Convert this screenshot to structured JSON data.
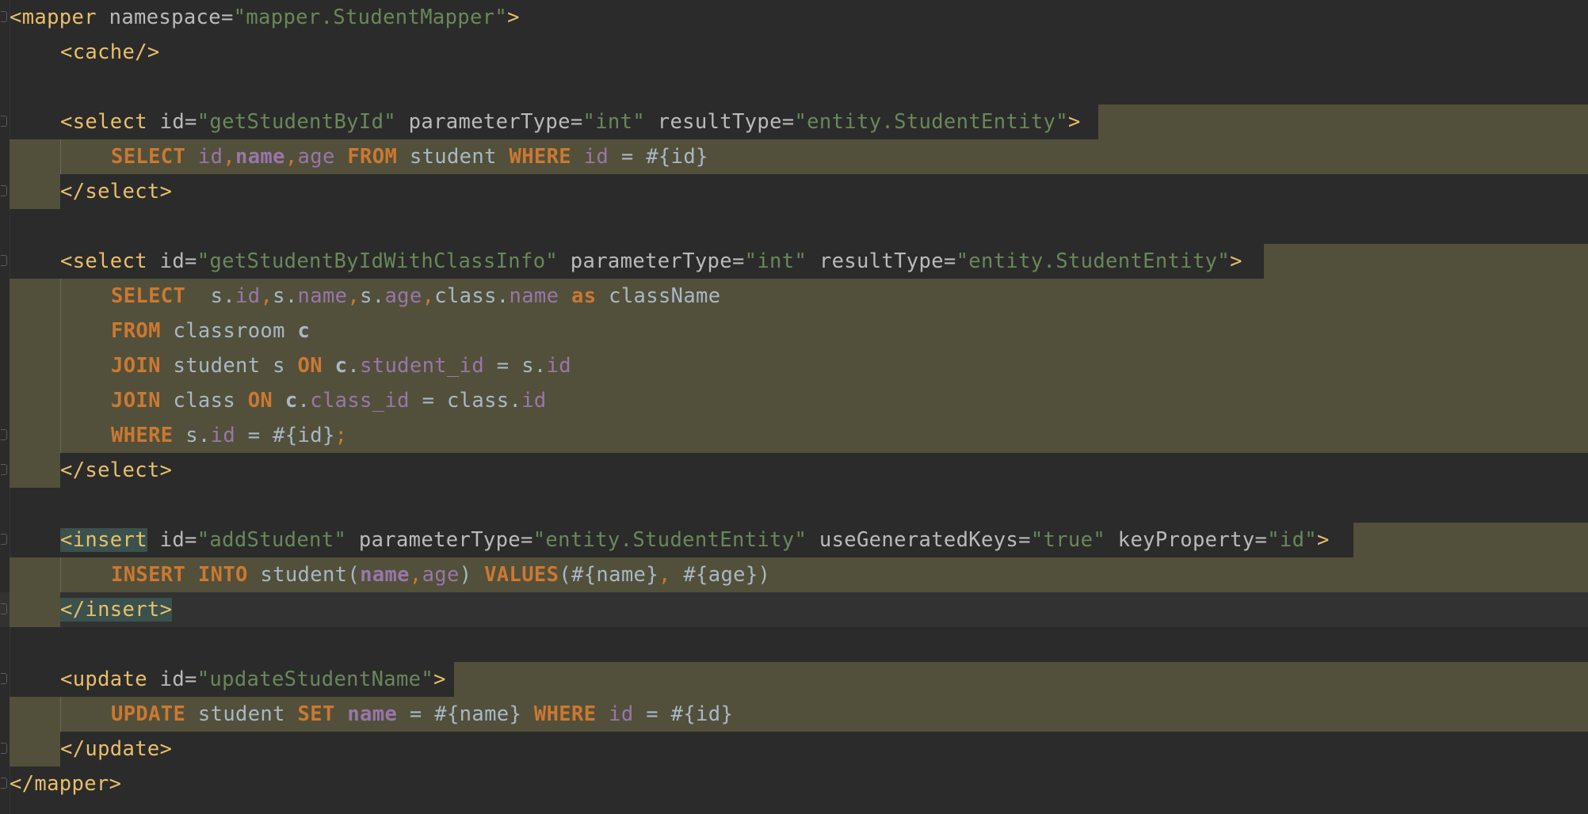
{
  "editor": {
    "language": "XML (MyBatis mapper)",
    "colors": {
      "background": "#2b2b2b",
      "injection_highlight": "#52503a",
      "xml_tag": "#e8bf6a",
      "attribute": "#bababa",
      "attribute_value": "#6a8759",
      "sql_keyword": "#cc7832",
      "sql_column": "#9876aa",
      "identifier": "#a9b7c6"
    }
  },
  "code": {
    "mapper_open": {
      "tag": "<mapper",
      "attr": " namespace=",
      "value": "\"mapper.StudentMapper\"",
      "close": ">"
    },
    "cache": "<cache/>",
    "select1": {
      "open": "<select",
      "id_attr": " id=",
      "id_val": "\"getStudentById\"",
      "pt_attr": " parameterType=",
      "pt_val": "\"int\"",
      "rt_attr": " resultType=",
      "rt_val": "\"entity.StudentEntity\"",
      "close": ">",
      "sql": [
        "SELECT",
        " ",
        "id",
        ",",
        "name",
        ",",
        "age",
        " ",
        "FROM",
        " student ",
        "WHERE",
        " ",
        "id",
        " = #{id}"
      ],
      "end": "</select>"
    },
    "select2": {
      "open": "<select",
      "id_attr": " id=",
      "id_val": "\"getStudentByIdWithClassInfo\"",
      "pt_attr": " parameterType=",
      "pt_val": "\"int\"",
      "rt_attr": " resultType=",
      "rt_val": "\"entity.StudentEntity\"",
      "close": ">",
      "line1": [
        "SELECT",
        "  s.",
        "id",
        ",",
        "s.",
        "name",
        ",",
        "s.",
        "age",
        ",",
        "class.",
        "name",
        " ",
        "as",
        " className"
      ],
      "line2": [
        "FROM",
        " classroom ",
        "c"
      ],
      "line3": [
        "JOIN",
        " student s ",
        "ON",
        " ",
        "c",
        ".",
        "student_id",
        " = s.",
        "id"
      ],
      "line4": [
        "JOIN",
        " class ",
        "ON",
        " ",
        "c",
        ".",
        "class_id",
        " = class.",
        "id"
      ],
      "line5": [
        "WHERE",
        " s.",
        "id",
        " = #{id}",
        ";"
      ],
      "end": "</select>"
    },
    "insert": {
      "open_bracket": "<",
      "open_name": "insert",
      "id_attr": " id=",
      "id_val": "\"addStudent\"",
      "pt_attr": " parameterType=",
      "pt_val": "\"entity.StudentEntity\"",
      "ugk_attr": " useGeneratedKeys=",
      "ugk_val": "\"true\"",
      "kp_attr": " keyProperty=",
      "kp_val": "\"id\"",
      "close": ">",
      "sql": [
        "INSERT",
        " ",
        "INTO",
        " student(",
        "name",
        ",",
        "age",
        ") ",
        "VALUES",
        "(#{name}",
        ",",
        " #{age})"
      ],
      "end": "</insert>"
    },
    "update": {
      "open": "<update",
      "id_attr": " id=",
      "id_val": "\"updateStudentName\"",
      "close": ">",
      "sql": [
        "UPDATE",
        " student ",
        "SET",
        " ",
        "name",
        " = #{name} ",
        "WHERE",
        " ",
        "id",
        " = #{id}"
      ],
      "end": "</update>"
    },
    "mapper_close": "</mapper>"
  }
}
